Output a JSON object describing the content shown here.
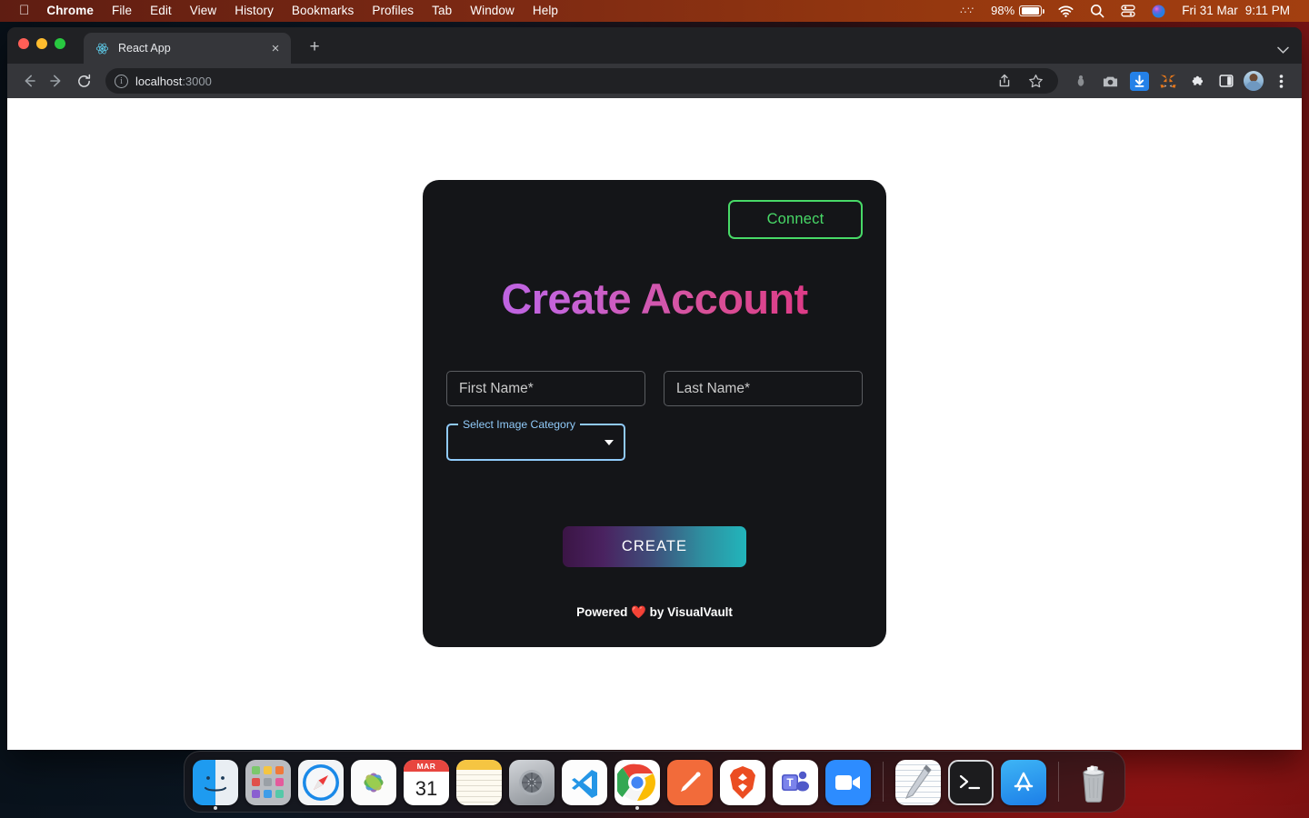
{
  "menubar": {
    "apple_icon": "apple-logo",
    "items": [
      {
        "label": "Chrome",
        "bold": true
      },
      {
        "label": "File",
        "bold": false
      },
      {
        "label": "Edit",
        "bold": false
      },
      {
        "label": "View",
        "bold": false
      },
      {
        "label": "History",
        "bold": false
      },
      {
        "label": "Bookmarks",
        "bold": false
      },
      {
        "label": "Profiles",
        "bold": false
      },
      {
        "label": "Tab",
        "bold": false
      },
      {
        "label": "Window",
        "bold": false
      },
      {
        "label": "Help",
        "bold": false
      }
    ],
    "status": {
      "control_strip_icon": "dots-icon",
      "battery_percent": "98%",
      "battery_icon": "battery-icon",
      "wifi_icon": "wifi-icon",
      "search_icon": "spotlight-search-icon",
      "control_center_icon": "control-center-icon",
      "siri_icon": "siri-icon",
      "date": "Fri 31 Mar",
      "time": "9:11 PM"
    },
    "bg_color": "#7e2a13"
  },
  "browser": {
    "traffic_lights": [
      "close",
      "minimize",
      "zoom"
    ],
    "tab": {
      "favicon": "react-logo-icon",
      "title": "React App",
      "close_label": "×"
    },
    "new_tab_label": "+",
    "tabstrip_menu_icon": "chevron-down-icon",
    "toolbar": {
      "back_icon": "arrow-left-icon",
      "forward_icon": "arrow-right-icon",
      "reload_icon": "reload-icon",
      "site_info_icon": "info-circle-icon",
      "url_host": "localhost",
      "url_port": ":3000",
      "share_icon": "share-icon",
      "bookmark_icon": "star-icon",
      "extensions": [
        "bug-icon",
        "camera-icon",
        "download-icon",
        "metamask-fox-icon",
        "puzzle-piece-icon",
        "side-panel-icon"
      ],
      "profile_icon": "avatar-icon",
      "menu_icon": "three-dot-menu-icon"
    }
  },
  "app": {
    "connect_button": "Connect",
    "title": "Create Account",
    "fields": {
      "first_name_placeholder": "First Name*",
      "last_name_placeholder": "Last Name*",
      "first_name_value": "",
      "last_name_value": ""
    },
    "select": {
      "label": "Select Image Category",
      "value": "",
      "arrow_icon": "chevron-down-icon"
    },
    "create_button": "CREATE",
    "footer": "Powered ❤️ by VisualVault",
    "colors": {
      "card_bg": "#141518",
      "page_bg": "#ffffff",
      "connect_green": "#48d967",
      "title_gradient_start": "#b863e8",
      "title_gradient_end": "#e0307e",
      "select_border": "#90caf9",
      "create_gradient_start": "#3b1545",
      "create_gradient_end": "#22b5bb"
    }
  },
  "dock": {
    "items": [
      {
        "name": "finder",
        "label": "Finder",
        "running": true
      },
      {
        "name": "launchpad",
        "label": "Launchpad",
        "running": false
      },
      {
        "name": "safari",
        "label": "Safari",
        "running": false
      },
      {
        "name": "photos",
        "label": "Photos",
        "running": false
      },
      {
        "name": "calendar",
        "label": "Calendar",
        "running": false,
        "month": "MAR",
        "day": "31"
      },
      {
        "name": "notes",
        "label": "Notes",
        "running": false
      },
      {
        "name": "system-preferences",
        "label": "System Preferences",
        "running": false
      },
      {
        "name": "vscode",
        "label": "Visual Studio Code",
        "running": true
      },
      {
        "name": "chrome",
        "label": "Google Chrome",
        "running": true
      },
      {
        "name": "postman",
        "label": "Postman",
        "running": false
      },
      {
        "name": "brave",
        "label": "Brave Browser",
        "running": false
      },
      {
        "name": "teams",
        "label": "Microsoft Teams",
        "running": false
      },
      {
        "name": "zoom",
        "label": "Zoom",
        "running": false
      },
      {
        "name": "textedit",
        "label": "TextEdit",
        "running": false
      },
      {
        "name": "terminal",
        "label": "Terminal",
        "running": false
      },
      {
        "name": "app-store",
        "label": "App Store",
        "running": false
      },
      {
        "name": "trash",
        "label": "Trash",
        "running": false
      }
    ]
  }
}
